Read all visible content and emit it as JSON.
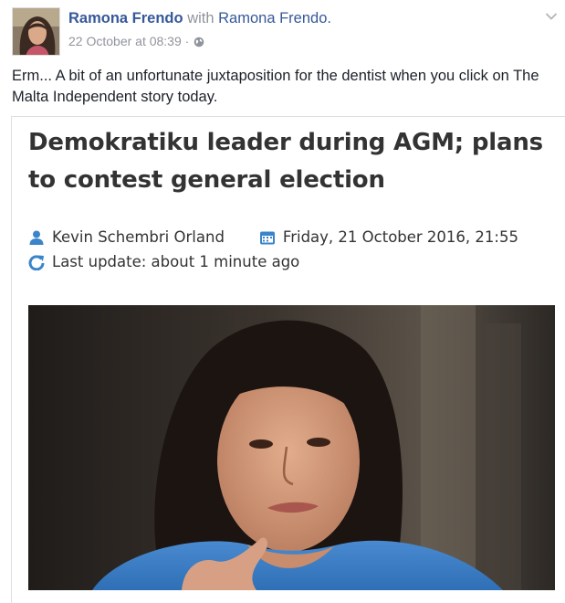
{
  "post": {
    "author": "Ramona Frendo",
    "with_text": "with",
    "tagged": "Ramona Frendo.",
    "timestamp": "22 October at 08:39 ·",
    "privacy_icon": "globe-icon",
    "menu_icon": "chevron-down-icon",
    "text": "Erm... A bit of an unfortunate juxtaposition for the dentist when you click on The Malta Independent story today."
  },
  "article": {
    "headline": "Demokratiku leader during AGM; plans to contest general election",
    "author": "Kevin Schembri Orland",
    "author_icon": "person-icon",
    "date": "Friday, 21 October 2016, 21:55",
    "date_icon": "calendar-icon",
    "update": "Last update: about 1 minute ago",
    "update_icon": "refresh-icon"
  },
  "colors": {
    "link": "#365899",
    "meta": "#90949c",
    "text": "#1d2129",
    "article_icon": "#3a84c9"
  }
}
